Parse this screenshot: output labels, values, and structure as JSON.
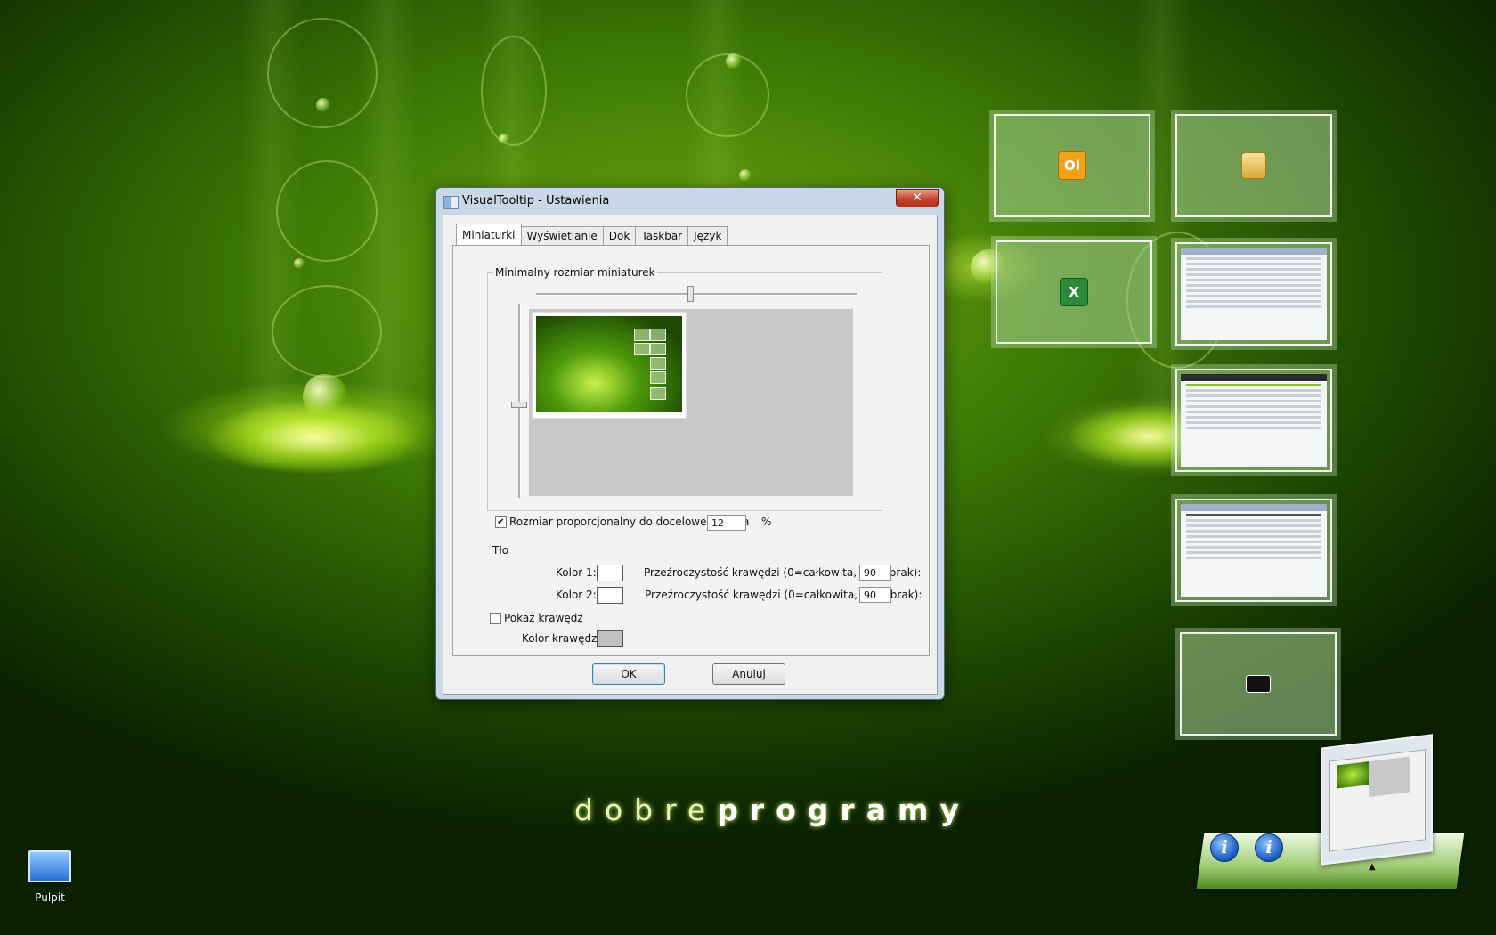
{
  "desktop": {
    "icon_label": "Pulpit",
    "brand_light": "dobre",
    "brand_bold": "programy"
  },
  "dialog": {
    "title": "VisualTooltip - Ustawienia",
    "close_symbol": "✕",
    "tabs": [
      {
        "label": "Miniaturki",
        "active": true
      },
      {
        "label": "Wyświetlanie",
        "active": false
      },
      {
        "label": "Dok",
        "active": false
      },
      {
        "label": "Taskbar",
        "active": false
      },
      {
        "label": "Język",
        "active": false
      }
    ],
    "group_label": "Minimalny rozmiar miniaturek",
    "proportional": {
      "label": "Rozmiar proporcjonalny do docelowego okna",
      "checked": true,
      "value": "12",
      "unit": "%"
    },
    "background_label": "Tło",
    "color1_label": "Kolor 1:",
    "color2_label": "Kolor 2:",
    "transparency_label_1": "Przeźroczystość krawędzi (0=całkowita, 255=brak):",
    "transparency_label_2": "Przeźroczystość krawędzi (0=całkowita, 255=brak):",
    "transparency_value_1": "90",
    "transparency_value_2": "90",
    "show_border": {
      "label": "Pokaż krawędź",
      "checked": false
    },
    "border_color_label": "Kolor krawędzi:",
    "color1": "#ffffff",
    "color2": "#ffffff",
    "border_color": "#c0c0c0",
    "ok_label": "OK",
    "cancel_label": "Anuluj",
    "check_mark": "✔"
  },
  "thumbnails": {
    "outlook_icon": "Ol",
    "excel_icon": "X",
    "camera_icon": "camera-icon",
    "folder_icon": "folder-icon"
  },
  "dock": {
    "info_symbol": "i",
    "arrow_symbol": "▲"
  },
  "colors": {
    "accent_green": "#6ea811",
    "dialog_frame": "#c9d8e6",
    "close_red": "#c7432b"
  }
}
